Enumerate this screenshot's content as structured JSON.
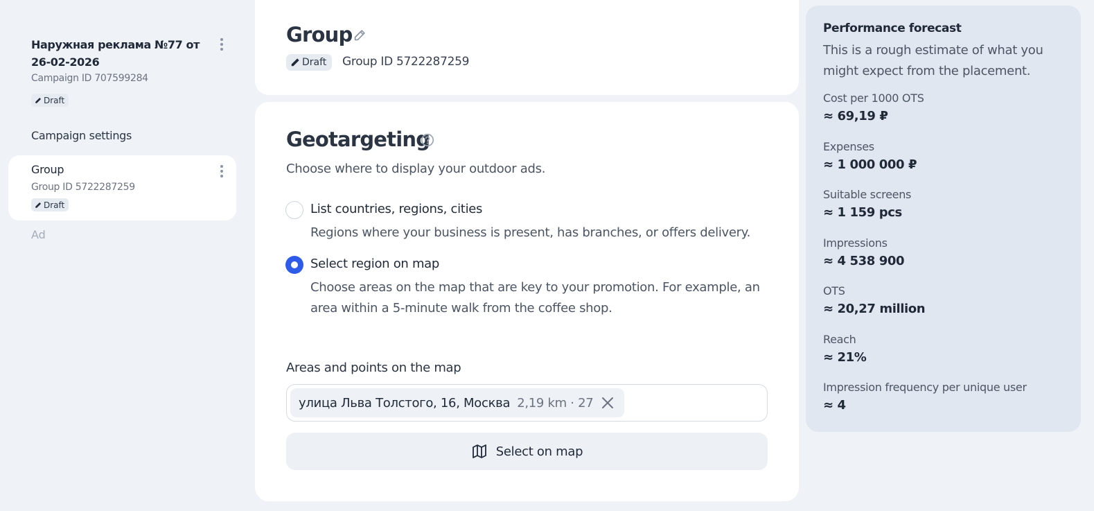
{
  "sidebar": {
    "campaign": {
      "title": "Наружная реклама №77 от 26-02-2026",
      "campaign_id": "Campaign ID 707599284",
      "badge": "Draft"
    },
    "section_label": "Campaign settings",
    "group": {
      "title": "Group",
      "group_id": "Group ID 5722287259",
      "badge": "Draft"
    },
    "ad_label": "Ad"
  },
  "header": {
    "title": "Group",
    "badge": "Draft",
    "group_id": "Group ID 5722287259"
  },
  "geotargeting": {
    "title": "Geotargeting",
    "description": "Choose where to display your outdoor ads.",
    "options": [
      {
        "label": "List countries, regions, cities",
        "help": "Regions where your business is present, has branches, or offers delivery.",
        "selected": false
      },
      {
        "label": "Select region on map",
        "help": "Choose areas on the map that are key to your promotion. For example, an area within a 5-minute walk from the coffee shop.",
        "selected": true
      }
    ],
    "areas_label": "Areas and points on the map",
    "chip": {
      "address": "улица Льва Толстого, 16, Москва",
      "meta": "2,19 km · 27"
    },
    "map_button_label": "Select on map"
  },
  "forecast": {
    "title": "Performance forecast",
    "description": "This is a rough estimate of what you might expect from the placement.",
    "metrics": [
      {
        "label": "Cost per 1000 OTS",
        "value": "≈ 69,19 ₽"
      },
      {
        "label": "Expenses",
        "value": "≈ 1 000 000 ₽"
      },
      {
        "label": "Suitable screens",
        "value": "≈ 1 159 pcs"
      },
      {
        "label": "Impressions",
        "value": "≈ 4 538 900"
      },
      {
        "label": "OTS",
        "value": "≈ 20,27 million"
      },
      {
        "label": "Reach",
        "value": "≈ 21%"
      },
      {
        "label": "Impression frequency per unique user",
        "value": "≈ 4"
      }
    ]
  },
  "colors": {
    "accent": "#2e5bea",
    "page_bg": "#eff2f6",
    "forecast_bg": "#e1e7f0"
  },
  "icons": [
    "kebab-menu-icon",
    "pencil-icon",
    "question-circle-icon",
    "close-icon",
    "map-icon"
  ]
}
